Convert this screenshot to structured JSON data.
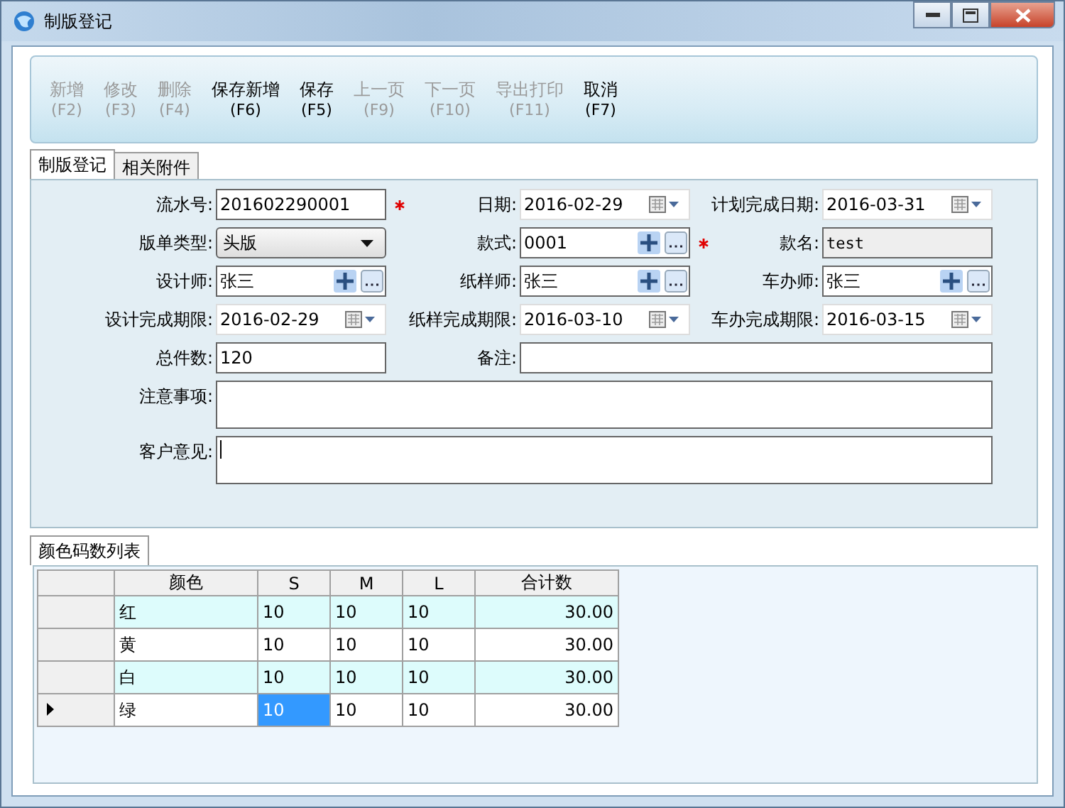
{
  "window": {
    "title": "制版登记"
  },
  "toolbar": [
    {
      "label": "新增",
      "key": "(F2)",
      "disabled": true
    },
    {
      "label": "修改",
      "key": "(F3)",
      "disabled": true
    },
    {
      "label": "删除",
      "key": "(F4)",
      "disabled": true
    },
    {
      "label": "保存新增",
      "key": "(F6)",
      "disabled": false
    },
    {
      "label": "保存",
      "key": "(F5)",
      "disabled": false
    },
    {
      "label": "上一页",
      "key": "(F9)",
      "disabled": true
    },
    {
      "label": "下一页",
      "key": "(F10)",
      "disabled": true
    },
    {
      "label": "导出打印",
      "key": "(F11)",
      "disabled": true
    },
    {
      "label": "取消",
      "key": "(F7)",
      "disabled": false
    }
  ],
  "tabs": [
    {
      "label": "制版登记",
      "selected": true
    },
    {
      "label": "相关附件",
      "selected": false
    }
  ],
  "form": {
    "rows": [
      [
        {
          "label": "流水号:",
          "value": "201602290001",
          "kind": "text",
          "required": true
        },
        {
          "label": "日期:",
          "value": "2016-02-29",
          "kind": "date"
        },
        {
          "label": "计划完成日期:",
          "value": "2016-03-31",
          "kind": "date"
        }
      ],
      [
        {
          "label": "版单类型:",
          "value": "头版",
          "kind": "combo"
        },
        {
          "label": "款式:",
          "value": "0001",
          "kind": "lookup",
          "required": true
        },
        {
          "label": "款名:",
          "value": "test",
          "kind": "readonly"
        }
      ],
      [
        {
          "label": "设计师:",
          "value": "张三",
          "kind": "lookup"
        },
        {
          "label": "纸样师:",
          "value": "张三",
          "kind": "lookup"
        },
        {
          "label": "车办师:",
          "value": "张三",
          "kind": "lookup"
        }
      ],
      [
        {
          "label": "设计完成期限:",
          "value": "2016-02-29",
          "kind": "date"
        },
        {
          "label": "纸样完成期限:",
          "value": "2016-03-10",
          "kind": "date"
        },
        {
          "label": "车办完成期限:",
          "value": "2016-03-15",
          "kind": "date"
        }
      ],
      [
        {
          "label": "总件数:",
          "value": "120",
          "kind": "text"
        },
        {
          "label": "备注:",
          "kind": "text"
        }
      ],
      [
        {
          "label": "注意事项:",
          "kind": "memo"
        }
      ],
      [
        {
          "label": "客户意见:",
          "kind": "memo",
          "focused": true
        }
      ]
    ]
  },
  "grid_tab": {
    "label": "颜色码数列表",
    "selected": true
  },
  "grid": {
    "columns": [
      "颜色",
      "S",
      "M",
      "L",
      "合计数"
    ],
    "rows": [
      {
        "current": false,
        "cells": [
          {
            "text": "红",
            "selected": false
          },
          {
            "text": "10",
            "selected": false
          },
          {
            "text": "10",
            "selected": false
          },
          {
            "text": "10",
            "selected": false
          },
          {
            "text": "30.00",
            "selected": false
          }
        ]
      },
      {
        "current": false,
        "cells": [
          {
            "text": "黄",
            "selected": false
          },
          {
            "text": "10",
            "selected": false
          },
          {
            "text": "10",
            "selected": false
          },
          {
            "text": "10",
            "selected": false
          },
          {
            "text": "30.00",
            "selected": false
          }
        ]
      },
      {
        "current": false,
        "cells": [
          {
            "text": "白",
            "selected": false
          },
          {
            "text": "10",
            "selected": false
          },
          {
            "text": "10",
            "selected": false
          },
          {
            "text": "10",
            "selected": false
          },
          {
            "text": "30.00",
            "selected": false
          }
        ]
      },
      {
        "current": true,
        "cells": [
          {
            "text": "绿",
            "selected": false
          },
          {
            "text": "10",
            "selected": true
          },
          {
            "text": "10",
            "selected": false
          },
          {
            "text": "10",
            "selected": false
          },
          {
            "text": "30.00",
            "selected": false
          }
        ]
      }
    ]
  }
}
